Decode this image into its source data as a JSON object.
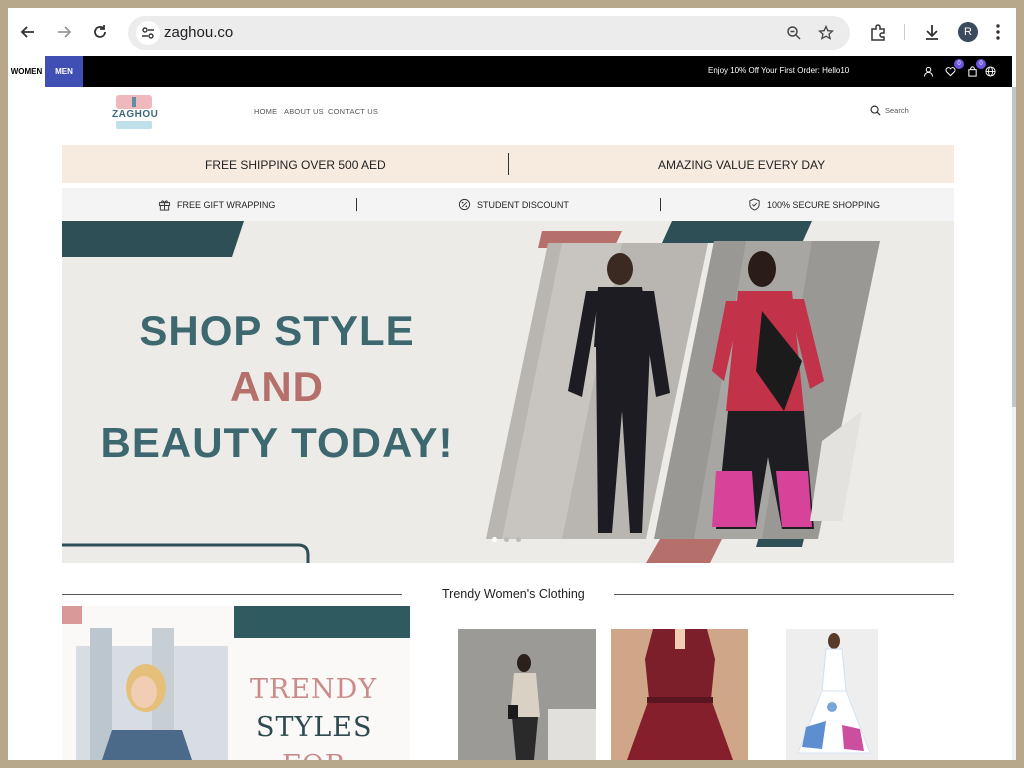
{
  "browser": {
    "url": "zaghou.co",
    "profile_initial": "R"
  },
  "topbar": {
    "women_label": "WOMEN",
    "men_label": "MEN",
    "promo_text": "Enjoy 10% Off Your First Order: Hello10",
    "wishlist_count": "0",
    "cart_count": "0"
  },
  "header": {
    "logo_text": "ZAGHOU",
    "nav": [
      "HOME",
      "ABOUT US",
      "CONTACT US"
    ],
    "search_label": "Search"
  },
  "benefits": {
    "strip1": [
      "FREE SHIPPING OVER 500 AED",
      "AMAZING VALUE EVERY DAY"
    ],
    "strip2": [
      "FREE GIFT WRAPPING",
      "STUDENT DISCOUNT",
      "100% SECURE SHOPPING"
    ]
  },
  "hero": {
    "line1": "SHOP STYLE",
    "line2": "AND",
    "line3": "BEAUTY TODAY!",
    "slide_count": 3,
    "active_slide": 1
  },
  "section": {
    "title": "Trendy Women's Clothing",
    "promo_line1": "TRENDY",
    "promo_line2": "STYLES",
    "promo_line3": "FOR"
  },
  "colors": {
    "brand_teal": "#2f4f56",
    "brand_rose": "#b5706c",
    "men_tab": "#3f4fb3",
    "strip_peach": "#f7ebe0",
    "badge": "#6b57e0"
  },
  "icons": [
    "back-icon",
    "forward-icon",
    "reload-icon",
    "site-settings-icon",
    "zoom-icon",
    "star-icon",
    "extensions-icon",
    "download-icon",
    "menu-icon",
    "user-icon",
    "heart-icon",
    "bag-icon",
    "globe-icon",
    "search-icon",
    "gift-icon",
    "discount-icon",
    "shield-icon"
  ]
}
